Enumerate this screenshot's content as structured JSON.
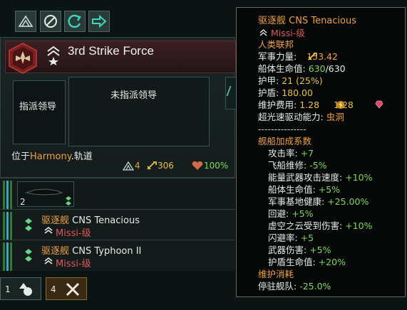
{
  "toolbar": {
    "buttons": [
      "fleet-formation-icon",
      "cancel-icon",
      "rotate-icon",
      "arrow-right-icon"
    ]
  },
  "fleet": {
    "name": "3rd Strike Force",
    "assign_leader": "指派领导",
    "no_leader": "未指派领导",
    "location_prefix": "位于",
    "location_planet": "Harmony",
    "location_suffix": ".轨道",
    "ship_count": "4",
    "power": "306",
    "health": "100%"
  },
  "ship_group": {
    "count": "2"
  },
  "ships": [
    {
      "class_prefix": "驱逐舰",
      "name": "CNS Tenacious",
      "design": "Missi-级"
    },
    {
      "class_prefix": "驱逐舰",
      "name": "CNS Typhoon II",
      "design": "Missi-级"
    }
  ],
  "bottom": {
    "btn1_count": "1",
    "btn2_count": "4"
  },
  "tooltip": {
    "ship_class": "驱逐舰",
    "ship_name": "CNS Tenacious",
    "design": "Missi-级",
    "empire": "人类联邦",
    "military_power_label": "军事力量:",
    "military_power_value": "153.42",
    "hull_label": "船体生命值:",
    "hull_value": "630",
    "hull_max": "/630",
    "armor_label": "护甲:",
    "armor_value": "21 (25%)",
    "shield_label": "护盾:",
    "shield_value": "180.00",
    "upkeep_label": "维护费用:",
    "upkeep_energy": "1.28",
    "upkeep_alloys": "1.28",
    "ftl_label": "超光速驱动能力:",
    "ftl_value": "虫洞",
    "separator": "---------------",
    "modifiers_title": "舰船加成系数",
    "modifiers": [
      {
        "label": "攻击率:",
        "value": "+7"
      },
      {
        "label": "飞船维修:",
        "value": "-5%"
      },
      {
        "label": "能量武器攻击速度:",
        "value": "+10%"
      },
      {
        "label": "船体生命值:",
        "value": "+5%"
      },
      {
        "label": "军事基地健康:",
        "value": "+25.00%"
      },
      {
        "label": "回避:",
        "value": "+5%"
      },
      {
        "label": "虚空之云受到伤害:",
        "value": "+10%"
      },
      {
        "label": "闪避率:",
        "value": "+5"
      },
      {
        "label": "武器伤害:",
        "value": "+5%"
      },
      {
        "label": "护盾生命值:",
        "value": "+20%"
      }
    ],
    "upkeep_title": "维护消耗",
    "docked_label": "停驻舰队:",
    "docked_value": "-25.0%"
  },
  "colors": {
    "orange": "#f0a040",
    "green": "#7ed957",
    "red": "#e05858",
    "panel_bg": "#141d1c"
  }
}
